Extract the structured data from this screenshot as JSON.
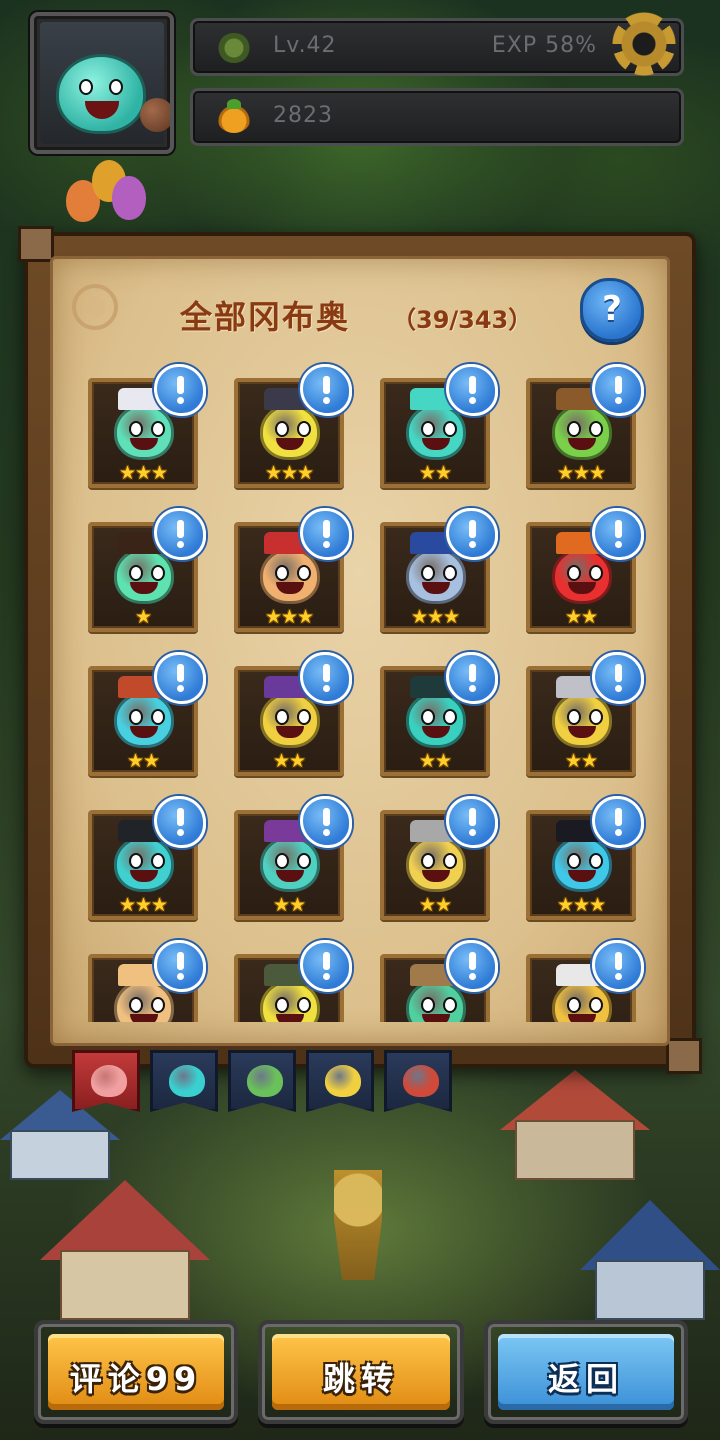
{
  "hud": {
    "level": "Lv.42",
    "exp": "EXP 58%",
    "gold": "2823"
  },
  "panel": {
    "title": "全部冈布奥",
    "count": "（39/343）"
  },
  "cards": [
    {
      "stars": "★★★",
      "color": "#5fe0b8",
      "hat": "#e8e8f0"
    },
    {
      "stars": "★★★",
      "color": "#f0e040",
      "hat": "#3a3a4a"
    },
    {
      "stars": "★★",
      "color": "#46d6c4",
      "hat": "#46d6c4"
    },
    {
      "stars": "★★★",
      "color": "#7ad04a",
      "hat": "#8a5a2a"
    },
    {
      "stars": "★",
      "color": "#5ee2b0",
      "hat": "#3a2418"
    },
    {
      "stars": "★★★",
      "color": "#f0b070",
      "hat": "#c83030"
    },
    {
      "stars": "★★★",
      "color": "#a8c0e0",
      "hat": "#2a4aa0"
    },
    {
      "stars": "★★",
      "color": "#e83030",
      "hat": "#e06a20"
    },
    {
      "stars": "★★",
      "color": "#48d0e0",
      "hat": "#c04a2a"
    },
    {
      "stars": "★★",
      "color": "#f0d040",
      "hat": "#6a3a9a"
    },
    {
      "stars": "★★",
      "color": "#3ad0c0",
      "hat": "#1f3a3a"
    },
    {
      "stars": "★★",
      "color": "#f0d040",
      "hat": "#c0c0c8"
    },
    {
      "stars": "★★★",
      "color": "#40d0d0",
      "hat": "#202428"
    },
    {
      "stars": "★★",
      "color": "#50d0c0",
      "hat": "#7a3a9a"
    },
    {
      "stars": "★★",
      "color": "#f0d050",
      "hat": "#a8a8a8"
    },
    {
      "stars": "★★★",
      "color": "#40c8e8",
      "hat": "#1a1a22"
    },
    {
      "stars": "",
      "color": "#f0c080",
      "hat": "#f0c080"
    },
    {
      "stars": "",
      "color": "#f0e040",
      "hat": "#4a5a3a"
    },
    {
      "stars": "",
      "color": "#50d0a0",
      "hat": "#a07a4a"
    },
    {
      "stars": "",
      "color": "#f0c040",
      "hat": "#e8e8e8"
    }
  ],
  "tabs": [
    {
      "color": "#f0a0a0"
    },
    {
      "color": "#3ad0d0"
    },
    {
      "color": "#6ac05a"
    },
    {
      "color": "#f0d040"
    },
    {
      "color": "#d04a3a"
    }
  ],
  "buttons": {
    "comment": "评论99",
    "jump": "跳转",
    "back": "返回"
  }
}
